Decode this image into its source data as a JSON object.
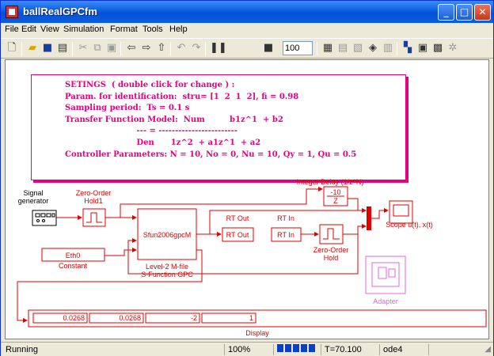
{
  "window": {
    "title": "ballRealGPCfm"
  },
  "menu": [
    "File",
    "Edit",
    "View",
    "Simulation",
    "Format",
    "Tools",
    "Help"
  ],
  "toolbar": {
    "stop_time": "100"
  },
  "settings_note": {
    "lines": [
      "SETINGS  ( double click for change ) :",
      "Param. for identification:  stru= [1  2  1  2], fi = 0.98",
      "Sampling period:  Ts = 0.1 s",
      "Transfer Function Model:  Num         b1z^1  + b2",
      "                          --- = ------------------------",
      "                          Den      1z^2  + a1z^1  + a2",
      "Controller Parameters: N = 10, No = 0, Nu = 10, Qy = 1, Qu = 0.5"
    ]
  },
  "blocks": {
    "signal_generator": {
      "label": "Signal\ngenerator",
      "l1": "Signal",
      "l2": "generator"
    },
    "zoh1": {
      "l1": "Zero-Order",
      "l2": "Hold1"
    },
    "sfun": {
      "inner": "Sfun2006gpcM",
      "l1": "Level-2 M-file",
      "l2": "S-Function GPC"
    },
    "constant": {
      "value": "Eth0",
      "label": "Constant"
    },
    "integer_delay": {
      "label": "Integer Delay (1/z^N)",
      "v1": "-10",
      "v2": "Z"
    },
    "rt_out": {
      "top": "RT Out",
      "inner": "RT Out"
    },
    "rt_in": {
      "top": "RT In",
      "inner": "RT In"
    },
    "zoh2": {
      "l1": "Zero-Order",
      "l2": "Hold"
    },
    "scope": {
      "label": "Scope u(t), x(t)"
    },
    "adapter": {
      "label": "Adapter"
    },
    "display": {
      "label": "Display",
      "values": [
        "0.0268",
        "0.0268",
        "-2",
        "1"
      ]
    }
  },
  "status": {
    "state": "Running",
    "zoom": "100%",
    "time": "T=70.100",
    "solver": "ode4",
    "progress": 1.0
  },
  "colors": {
    "wire": "#e00000",
    "accent": "#e6007e",
    "adapter": "#e066e0"
  }
}
